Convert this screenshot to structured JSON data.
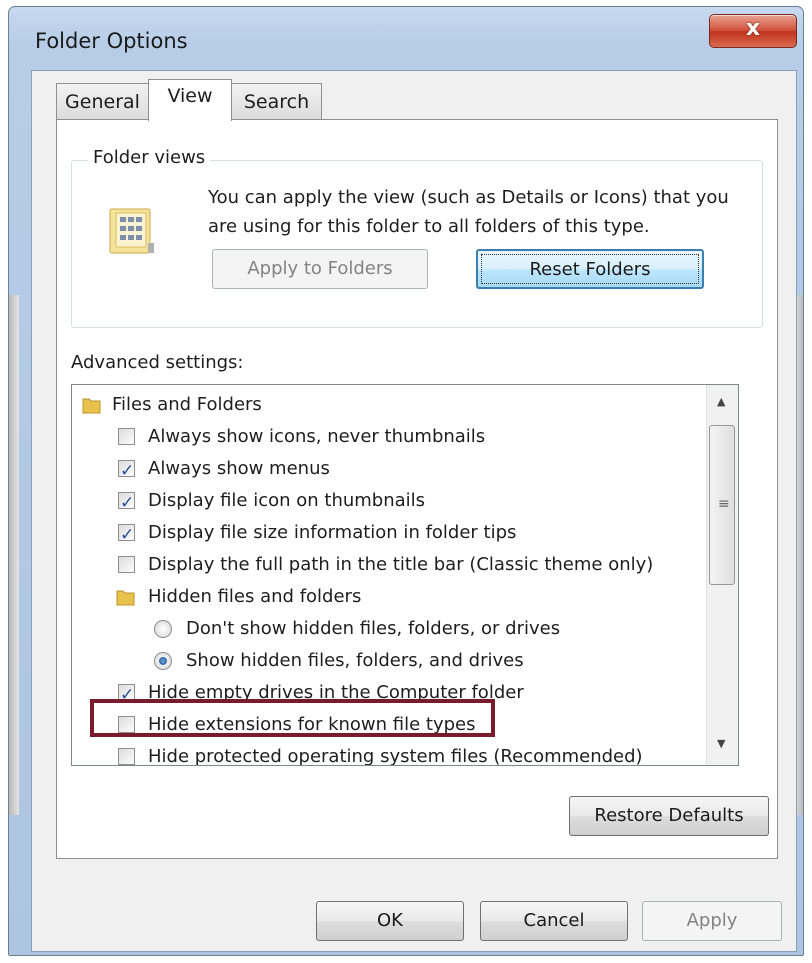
{
  "window": {
    "title": "Folder Options",
    "close_label": "x"
  },
  "tabs": [
    {
      "label": "General",
      "active": false
    },
    {
      "label": "View",
      "active": true
    },
    {
      "label": "Search",
      "active": false
    }
  ],
  "folder_views": {
    "label": "Folder views",
    "description": "You can apply the view (such as Details or Icons) that you are using for this folder to all folders of this type.",
    "apply_button": "Apply to Folders",
    "reset_button": "Reset Folders"
  },
  "advanced": {
    "label": "Advanced settings:",
    "items": [
      {
        "type": "folder",
        "text": "Files and Folders",
        "indent": 0
      },
      {
        "type": "checkbox",
        "text": "Always show icons, never thumbnails",
        "checked": false,
        "indent": 1
      },
      {
        "type": "checkbox",
        "text": "Always show menus",
        "checked": true,
        "indent": 1
      },
      {
        "type": "checkbox",
        "text": "Display file icon on thumbnails",
        "checked": true,
        "indent": 1
      },
      {
        "type": "checkbox",
        "text": "Display file size information in folder tips",
        "checked": true,
        "indent": 1
      },
      {
        "type": "checkbox",
        "text": "Display the full path in the title bar (Classic theme only)",
        "checked": false,
        "indent": 1
      },
      {
        "type": "folder",
        "text": "Hidden files and folders",
        "indent": 1
      },
      {
        "type": "radio",
        "text": "Don't show hidden files, folders, or drives",
        "checked": false,
        "indent": 2
      },
      {
        "type": "radio",
        "text": "Show hidden files, folders, and drives",
        "checked": true,
        "indent": 2
      },
      {
        "type": "checkbox",
        "text": "Hide empty drives in the Computer folder",
        "checked": true,
        "indent": 1
      },
      {
        "type": "checkbox",
        "text": "Hide extensions for known file types",
        "checked": false,
        "indent": 1
      },
      {
        "type": "checkbox",
        "text": "Hide protected operating system files (Recommended)",
        "checked": false,
        "indent": 1
      }
    ]
  },
  "buttons": {
    "restore": "Restore Defaults",
    "ok": "OK",
    "cancel": "Cancel",
    "apply": "Apply"
  },
  "colors": {
    "highlight_box": "#7a1a2a",
    "focus_border": "#3c7fb1"
  }
}
